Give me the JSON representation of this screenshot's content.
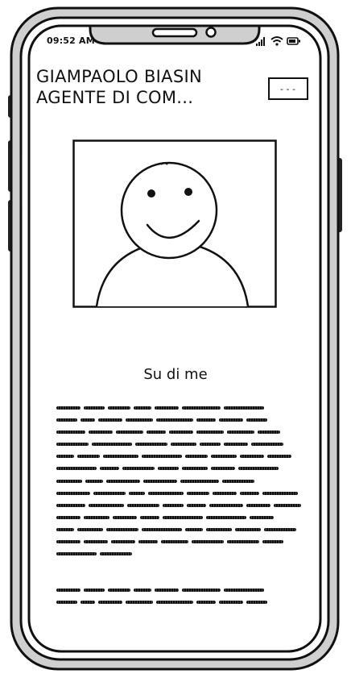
{
  "status_bar": {
    "time": "09:52 AM",
    "icons": [
      "signal-icon",
      "wifi-icon",
      "battery-icon"
    ]
  },
  "header": {
    "title_line1": "GIAMPAOLO BIASIN",
    "title_line2": "AGENTE DI COM...",
    "menu_label": "---"
  },
  "profile": {
    "avatar_icon": "smiley-person-icon"
  },
  "about": {
    "heading": "Su di me",
    "paragraph1_lines": 13,
    "paragraph2_lines": 2
  },
  "colors": {
    "ink": "#111111",
    "phone_body": "#cccccc",
    "screen": "#ffffff"
  }
}
